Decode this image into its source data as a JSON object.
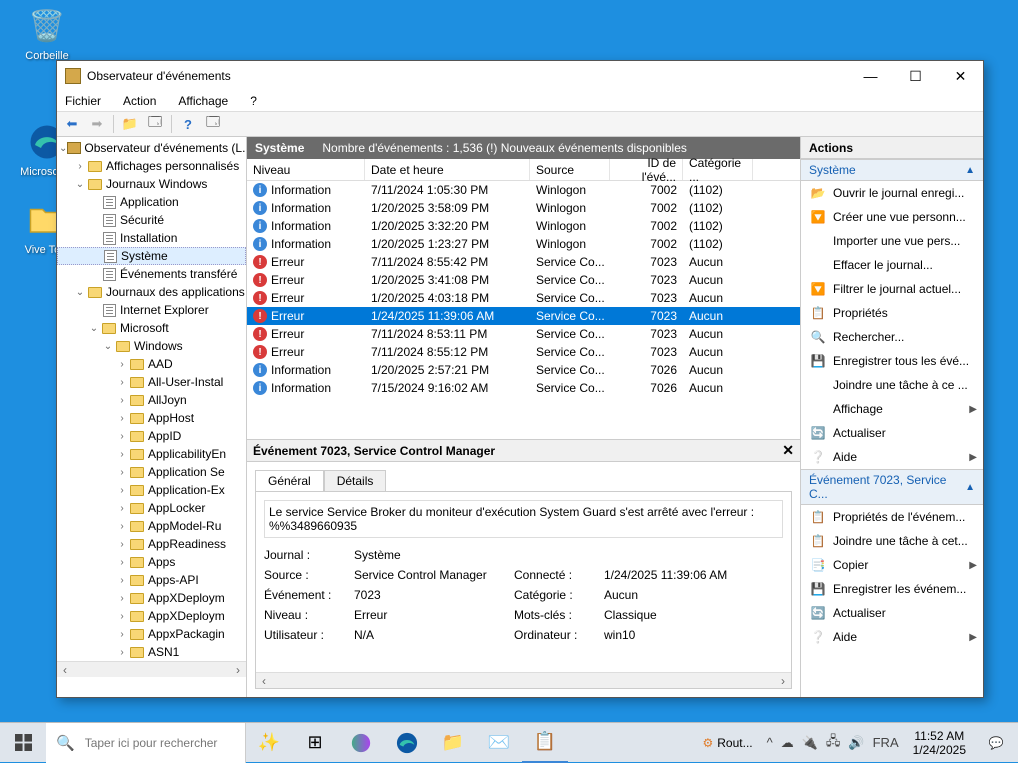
{
  "desktop_icons": [
    {
      "label": "Corbeille"
    },
    {
      "label": "Microsoft..."
    },
    {
      "label": "Vive To..."
    }
  ],
  "window": {
    "title": "Observateur d'événements",
    "menu": [
      "Fichier",
      "Action",
      "Affichage",
      "?"
    ]
  },
  "tree": {
    "root": "Observateur d'événements (L...",
    "n_aff": "Affichages personnalisés",
    "n_jw": "Journaux Windows",
    "jw": [
      "Application",
      "Sécurité",
      "Installation",
      "Système",
      "Événements transféré"
    ],
    "n_ja": "Journaux des applications",
    "n_ie": "Internet Explorer",
    "n_ms": "Microsoft",
    "n_win": "Windows",
    "win_children": [
      "AAD",
      "All-User-Instal",
      "AllJoyn",
      "AppHost",
      "AppID",
      "ApplicabilityEn",
      "Application Se",
      "Application-Ex",
      "AppLocker",
      "AppModel-Ru",
      "AppReadiness",
      "Apps",
      "Apps-API",
      "AppXDeploym",
      "AppXDeploym",
      "AppxPackagin",
      "ASN1"
    ]
  },
  "list": {
    "hdr_title": "Système",
    "hdr_count": "Nombre d'événements : 1,536 (!) Nouveaux événements disponibles",
    "cols": [
      "Niveau",
      "Date et heure",
      "Source",
      "ID de l'évé...",
      "Catégorie ..."
    ],
    "rows": [
      {
        "lvl": "Information",
        "date": "7/11/2024 1:05:30 PM",
        "src": "Winlogon",
        "id": "7002",
        "cat": "(1102)"
      },
      {
        "lvl": "Information",
        "date": "1/20/2025 3:58:09 PM",
        "src": "Winlogon",
        "id": "7002",
        "cat": "(1102)"
      },
      {
        "lvl": "Information",
        "date": "1/20/2025 3:32:20 PM",
        "src": "Winlogon",
        "id": "7002",
        "cat": "(1102)"
      },
      {
        "lvl": "Information",
        "date": "1/20/2025 1:23:27 PM",
        "src": "Winlogon",
        "id": "7002",
        "cat": "(1102)"
      },
      {
        "lvl": "Erreur",
        "date": "7/11/2024 8:55:42 PM",
        "src": "Service Co...",
        "id": "7023",
        "cat": "Aucun"
      },
      {
        "lvl": "Erreur",
        "date": "1/20/2025 3:41:08 PM",
        "src": "Service Co...",
        "id": "7023",
        "cat": "Aucun"
      },
      {
        "lvl": "Erreur",
        "date": "1/20/2025 4:03:18 PM",
        "src": "Service Co...",
        "id": "7023",
        "cat": "Aucun"
      },
      {
        "lvl": "Erreur",
        "date": "1/24/2025 11:39:06 AM",
        "src": "Service Co...",
        "id": "7023",
        "cat": "Aucun",
        "sel": true
      },
      {
        "lvl": "Erreur",
        "date": "7/11/2024 8:53:11 PM",
        "src": "Service Co...",
        "id": "7023",
        "cat": "Aucun"
      },
      {
        "lvl": "Erreur",
        "date": "7/11/2024 8:55:12 PM",
        "src": "Service Co...",
        "id": "7023",
        "cat": "Aucun"
      },
      {
        "lvl": "Information",
        "date": "1/20/2025 2:57:21 PM",
        "src": "Service Co...",
        "id": "7026",
        "cat": "Aucun"
      },
      {
        "lvl": "Information",
        "date": "7/15/2024 9:16:02 AM",
        "src": "Service Co...",
        "id": "7026",
        "cat": "Aucun"
      }
    ]
  },
  "detail": {
    "title": "Événement 7023, Service Control Manager",
    "tabs": [
      "Général",
      "Détails"
    ],
    "message": "Le service Service Broker du moniteur d'exécution System Guard s'est arrêté avec l'erreur :",
    "message2": "%%3489660935",
    "labels": {
      "journal": "Journal :",
      "source": "Source :",
      "evenement": "Événement :",
      "niveau": "Niveau :",
      "utilisateur": "Utilisateur :",
      "connecte": "Connecté :",
      "categorie": "Catégorie :",
      "motscles": "Mots-clés :",
      "ordinateur": "Ordinateur :"
    },
    "values": {
      "journal": "Système",
      "source": "Service Control Manager",
      "evenement": "7023",
      "niveau": "Erreur",
      "utilisateur": "N/A",
      "connecte": "1/24/2025 11:39:06 AM",
      "categorie": "Aucun",
      "motscles": "Classique",
      "ordinateur": "win10"
    }
  },
  "actions": {
    "title": "Actions",
    "sec1_title": "Système",
    "sec1": [
      "Ouvrir le journal enregi...",
      "Créer une vue personn...",
      "Importer une vue pers...",
      "Effacer le journal...",
      "Filtrer le journal actuel...",
      "Propriétés",
      "Rechercher...",
      "Enregistrer tous les évé...",
      "Joindre une tâche à ce ...",
      "Affichage",
      "Actualiser",
      "Aide"
    ],
    "sec2_title": "Événement 7023, Service C...",
    "sec2": [
      "Propriétés de l'événem...",
      "Joindre une tâche à cet...",
      "Copier",
      "Enregistrer les événem...",
      "Actualiser",
      "Aide"
    ]
  },
  "taskbar": {
    "search_placeholder": "Taper ici pour rechercher",
    "running_label": "Rout...",
    "lang": "FRA",
    "time": "11:52 AM",
    "date": "1/24/2025"
  }
}
